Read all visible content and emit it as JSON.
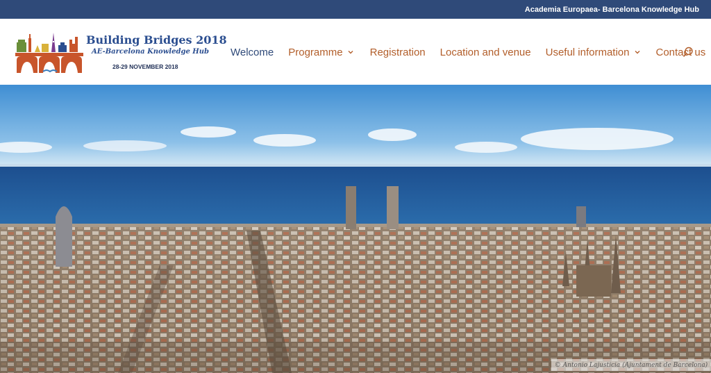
{
  "topbar": {
    "text": "Academia Europaea- Barcelona Knowledge Hub"
  },
  "logo": {
    "title": "Building Bridges 2018",
    "subtitle": "AE-Barcelona Knowledge Hub",
    "date": "28-29 NOVEMBER 2018"
  },
  "nav": {
    "items": [
      {
        "label": "Welcome",
        "active": true,
        "dropdown": false
      },
      {
        "label": "Programme",
        "active": false,
        "dropdown": true
      },
      {
        "label": "Registration",
        "active": false,
        "dropdown": false
      },
      {
        "label": "Location and venue",
        "active": false,
        "dropdown": false
      },
      {
        "label": "Useful information",
        "active": false,
        "dropdown": true
      },
      {
        "label": "Contact us",
        "active": false,
        "dropdown": false
      }
    ],
    "search_icon": "search-icon"
  },
  "hero": {
    "credit": "© Antonio Lajusticia (Ajuntament de Barcelona)"
  },
  "colors": {
    "topbar_bg": "#2f4a79",
    "nav_active": "#2f4a79",
    "nav_link": "#b25e2a",
    "logo_blue": "#2b4e90",
    "logo_arch": "#c8552b"
  }
}
